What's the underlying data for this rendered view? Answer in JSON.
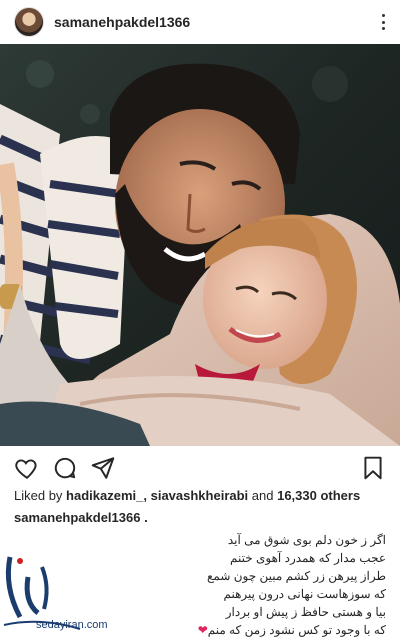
{
  "post": {
    "username": "samanehpakdel1366",
    "likes": {
      "prefix": "Liked by ",
      "user1": "hadikazemi_",
      "separator": ", ",
      "user2": "siavashkheirabi",
      "middle": " and ",
      "count": "16,330 others"
    },
    "caption_username": "samanehpakdel1366 .",
    "caption_lines": [
      "اگر ز خون دلم بوی شوق می آید",
      "عجب مدار که همدرد آهوی ختنم",
      "طراز پیرهن زر کشم مبین چون شمع",
      "که سوزهاست نهانی درون پیرهنم",
      "بیا و هستی حافظ ز پیش او بردار",
      "که با وجود تو کس نشود زمن که منم"
    ],
    "caption_end_emoji": "❤"
  },
  "icons": {
    "more": "more-vertical-icon",
    "like": "heart-icon",
    "comment": "comment-icon",
    "share": "direct-share-icon",
    "save": "bookmark-icon"
  },
  "watermark": {
    "site": "sedayiran.com"
  },
  "colors": {
    "text": "#262626",
    "heart": "#e0245e",
    "watermark": "#1b3d6e"
  }
}
